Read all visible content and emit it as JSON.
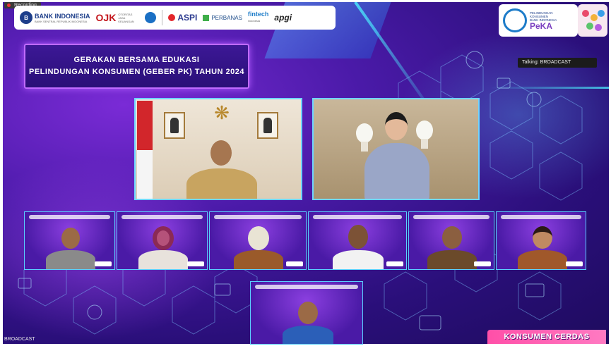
{
  "recording": {
    "label": "Recording"
  },
  "logos": {
    "bi": "BANK INDONESIA",
    "bi_sub": "BANK SENTRAL REPUBLIK INDONESIA",
    "ojk": "OJK",
    "ojk_sub": "OTORITAS JASA KEUANGAN",
    "aspi": "ASPI",
    "perbanas": "PERBANAS",
    "fintech": "fintech",
    "fintech_sub": "indonesia",
    "apgi": "apgi"
  },
  "peka": {
    "line1": "PELINDUNGAN",
    "line2": "KONSUMEN",
    "line3": "BANK INDONESIA",
    "brand": "PeKA"
  },
  "talking": "Talking: BROADCAST",
  "banner": {
    "line1": "GERAKAN BERSAMA EDUKASI",
    "line2": "PELINDUNGAN KONSUMEN (GEBER PK) TAHUN 2024"
  },
  "broadcast_label": "BROADCAST",
  "konsumen": "KONSUMEN CERDAS",
  "colors": {
    "accent": "#6fd5ff",
    "banner_border": "#c06bff",
    "konsumen": "#ff4fa8"
  }
}
